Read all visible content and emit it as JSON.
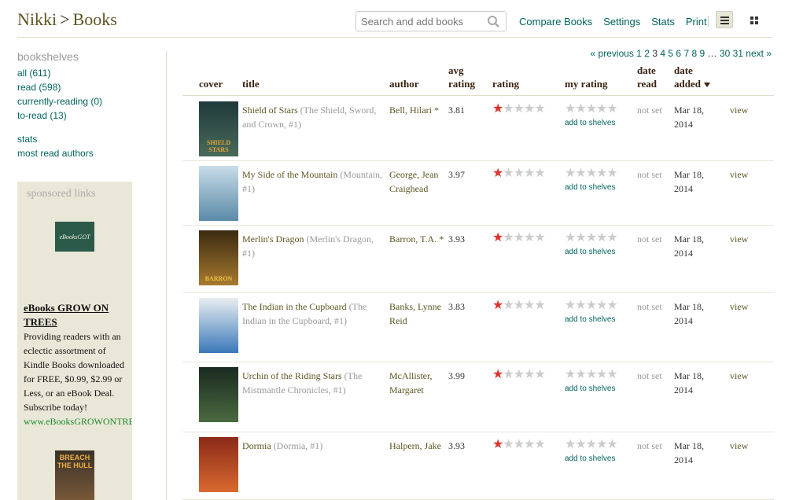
{
  "header": {
    "user": "Nikki",
    "separator": ">",
    "section": "Books",
    "search_placeholder": "Search and add books",
    "links": [
      "Compare Books",
      "Settings",
      "Stats",
      "Print"
    ]
  },
  "sidebar": {
    "title": "bookshelves",
    "shelves": [
      "all (611)",
      "read (598)",
      "currently-reading (0)",
      "to-read (13)"
    ],
    "extras": [
      "stats",
      "most read authors"
    ]
  },
  "sponsor": {
    "title": "sponsored links",
    "logo_text": "eBooksGOT",
    "ad_title": "eBooks GROW ON TREES",
    "ad_text": "Providing readers with an eclectic assortment of Kindle Books downloaded for FREE, $0.99, $2.99 or Less, or an eBook Deal. Subscribe today!",
    "ad_url": "www.eBooksGROWONTREES.com",
    "book_text": "BREACH THE HULL"
  },
  "pager": {
    "previous": "« previous",
    "pages": [
      "1",
      "2",
      "3",
      "4",
      "5",
      "6",
      "7",
      "8",
      "9"
    ],
    "current": "3",
    "ellipsis": "…",
    "last_pages": [
      "30",
      "31"
    ],
    "next": "next »"
  },
  "table": {
    "headers": {
      "cover": "cover",
      "title": "title",
      "author": "author",
      "avg1": "avg",
      "avg2": "rating",
      "rating": "rating",
      "my_rating": "my rating",
      "date_read1": "date",
      "date_read2": "read",
      "date_added1": "date",
      "date_added2": "added"
    },
    "add_to_shelves": "add to shelves",
    "view": "view",
    "rows": [
      {
        "title": "Shield of Stars",
        "series": "(The Shield, Sword, and Crown, #1)",
        "author": "Bell, Hilari *",
        "avg": "3.81",
        "stars": 1,
        "date_read": "not set",
        "date_added": "Mar 18, 2014",
        "cover_text": "SHIELD STARS",
        "cover_colors": [
          "#1e3a3a",
          "#4a6a5a"
        ],
        "cover_text_color": "#e8a83a"
      },
      {
        "title": "My Side of the Mountain",
        "series": "(Mountain, #1)",
        "author": "George, Jean Craighead",
        "avg": "3.97",
        "stars": 1,
        "date_read": "not set",
        "date_added": "Mar 18, 2014",
        "cover_text": "",
        "cover_colors": [
          "#c8dce8",
          "#5a8aa8"
        ],
        "cover_text_color": "#fff"
      },
      {
        "title": "Merlin's Dragon",
        "series": "(Merlin's Dragon, #1)",
        "author": "Barron, T.A. *",
        "avg": "3.93",
        "stars": 1,
        "date_read": "not set",
        "date_added": "Mar 18, 2014",
        "cover_text": "BARRON",
        "cover_colors": [
          "#3a2a10",
          "#a87a30"
        ],
        "cover_text_color": "#f0c040"
      },
      {
        "title": "The Indian in the Cupboard",
        "series": "(The Indian in the Cupboard, #1)",
        "author": "Banks, Lynne Reid",
        "avg": "3.83",
        "stars": 1,
        "date_read": "not set",
        "date_added": "Mar 18, 2014",
        "cover_text": "",
        "cover_colors": [
          "#e8eef2",
          "#3a78b8"
        ],
        "cover_text_color": "#fff"
      },
      {
        "title": "Urchin of the Riding Stars",
        "series": "(The Mistmantle Chronicles, #1)",
        "author": "McAllister, Margaret",
        "avg": "3.99",
        "stars": 1,
        "date_read": "not set",
        "date_added": "Mar 18, 2014",
        "cover_text": "",
        "cover_colors": [
          "#1a2a20",
          "#4a6a40"
        ],
        "cover_text_color": "#e0d080"
      },
      {
        "title": "Dormia",
        "series": "(Dormia, #1)",
        "author": "Halpern, Jake",
        "avg": "3.93",
        "stars": 1,
        "date_read": "not set",
        "date_added": "Mar 18, 2014",
        "cover_text": "",
        "cover_colors": [
          "#8a2a18",
          "#d86a30"
        ],
        "cover_text_color": "#fff"
      }
    ]
  }
}
